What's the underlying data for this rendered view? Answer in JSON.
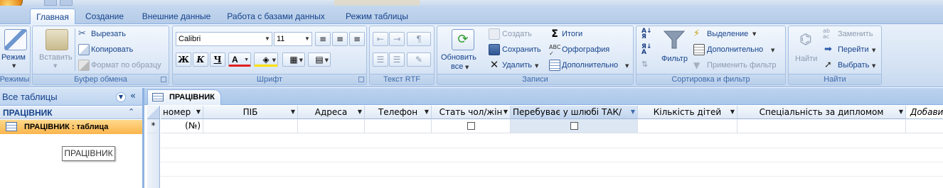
{
  "ribbon_tabs": [
    {
      "label": "Главная",
      "active": true
    },
    {
      "label": "Создание",
      "active": false
    },
    {
      "label": "Внешние данные",
      "active": false
    },
    {
      "label": "Работа с базами данных",
      "active": false
    },
    {
      "label": "Режим таблицы",
      "active": false
    }
  ],
  "groups": {
    "modes": {
      "label": "Режимы",
      "view_button": "Режим",
      "view_icon": "design-view-icon"
    },
    "clipboard": {
      "label": "Буфер обмена",
      "paste": "Вставить",
      "paste_icon": "paste-icon",
      "cut": "Вырезать",
      "cut_icon": "scissors-icon",
      "copy": "Копировать",
      "copy_icon": "copy-icon",
      "format_painter": "Формат по образцу",
      "format_painter_icon": "brush-icon"
    },
    "font": {
      "label": "Шрифт",
      "font_name": "Calibri",
      "font_size": "11",
      "bold": "Ж",
      "italic": "К",
      "underline": "Ч",
      "font_color_glyph": "A",
      "font_color": "#e02020",
      "fill_color": "#ffe000"
    },
    "rich_text": {
      "label": "Текст RTF",
      "icons": [
        "decrease-indent-icon",
        "increase-indent-icon",
        "paragraph-direction-icon",
        "numbering-icon",
        "bullets-icon",
        "highlight-icon"
      ]
    },
    "records": {
      "label": "Записи",
      "refresh": "Обновить",
      "refresh2": "все",
      "new": "Создать",
      "save": "Сохранить",
      "delete": "Удалить",
      "totals": "Итоги",
      "spelling": "Орфография",
      "more": "Дополнительно"
    },
    "sort_filter": {
      "label": "Сортировка и фильтр",
      "filter": "Фильтр",
      "selection": "Выделение",
      "advanced": "Дополнительно",
      "toggle_filter": "Применить фильтр"
    },
    "find": {
      "label": "Найти",
      "find": "Найти",
      "replace": "Заменить",
      "goto": "Перейти",
      "select": "Выбрать"
    }
  },
  "nav_pane": {
    "title": "Все таблицы",
    "group": "ПРАЦІВНИК",
    "item": "ПРАЦІВНИК : таблица",
    "tooltip": "ПРАЦІВНИК"
  },
  "document": {
    "tab_label": "ПРАЦІВНИК"
  },
  "table": {
    "columns": [
      {
        "label": "номер",
        "selected": false
      },
      {
        "label": "ПІБ",
        "selected": false
      },
      {
        "label": "Адреса",
        "selected": false
      },
      {
        "label": "Телефон",
        "selected": false
      },
      {
        "label": "Стать чол/жін",
        "selected": false
      },
      {
        "label": "Перебуває у шлюбі ТАК/",
        "selected": true
      },
      {
        "label": "Кількість дітей",
        "selected": false
      },
      {
        "label": "Спеціальність за дипломом",
        "selected": false
      }
    ],
    "add_field": "Добави",
    "new_row_marker": "*",
    "new_row_number": "(№)"
  },
  "colors": {
    "accent": "#15428b",
    "ribbon_border": "#8db2e3",
    "nav_item_highlight": "#fbb54c"
  }
}
